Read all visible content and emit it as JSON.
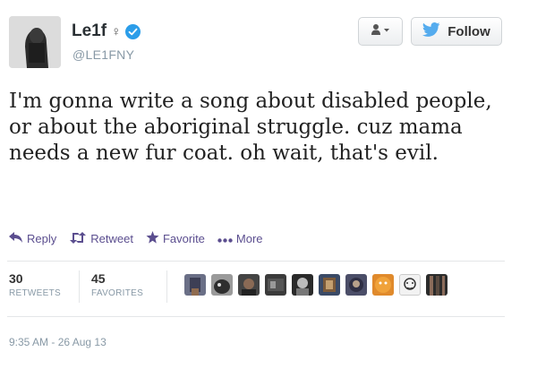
{
  "author": {
    "name": "Le1f",
    "gender_symbol": "♀",
    "handle": "@LE1FNY",
    "verified": true
  },
  "buttons": {
    "follow_label": "Follow",
    "user_menu_icon": "user-dropdown-icon"
  },
  "tweet": {
    "text": "I'm gonna write a song about disabled people, or about the aboriginal struggle. cuz mama needs a new fur coat. oh wait, that's evil."
  },
  "actions": {
    "reply": "Reply",
    "retweet": "Retweet",
    "favorite": "Favorite",
    "more": "More"
  },
  "stats": {
    "retweets_count": "30",
    "retweets_label": "RETWEETS",
    "favorites_count": "45",
    "favorites_label": "FAVORITES"
  },
  "favoriters_count": 10,
  "timestamp": "9:35 AM - 26 Aug 13",
  "colors": {
    "accent": "#5b4e8f",
    "verified": "#2b9de9",
    "twitter_bird": "#55acee"
  }
}
